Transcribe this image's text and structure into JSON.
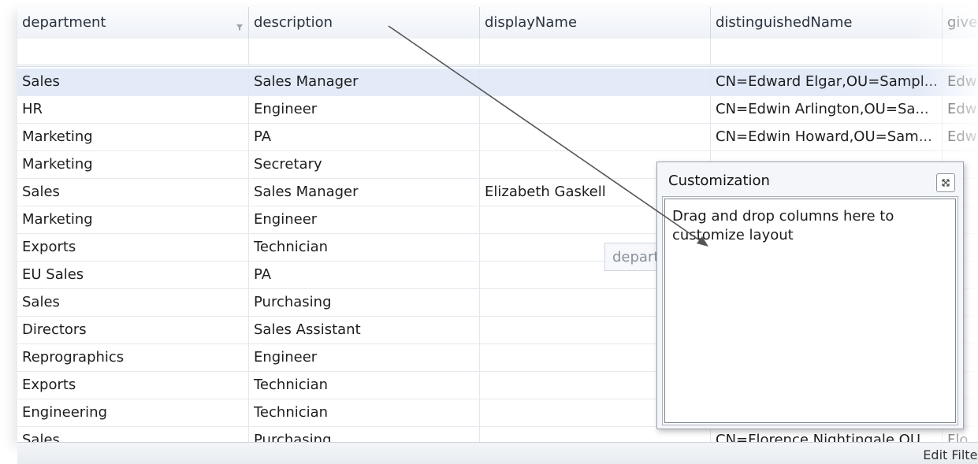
{
  "grid": {
    "columns": [
      "department",
      "description",
      "displayName",
      "distinguishedName",
      "givenName"
    ],
    "rows": [
      [
        "Sales",
        "Sales Manager",
        "",
        "CN=Edward Elgar,OU=Sampl...",
        "Edw"
      ],
      [
        "HR",
        "Engineer",
        "",
        "CN=Edwin Arlington,OU=Sa...",
        "Edw"
      ],
      [
        "Marketing",
        "PA",
        "",
        "CN=Edwin Howard,OU=Sam...",
        "Edw"
      ],
      [
        "Marketing",
        "Secretary",
        "",
        "",
        ""
      ],
      [
        "Sales",
        "Sales Manager",
        "Elizabeth Gaskell",
        "",
        ""
      ],
      [
        "Marketing",
        "Engineer",
        "",
        "",
        ""
      ],
      [
        "Exports",
        "Technician",
        "",
        "",
        ""
      ],
      [
        "EU Sales",
        "PA",
        "",
        "",
        ""
      ],
      [
        "Sales",
        "Purchasing",
        "",
        "",
        ""
      ],
      [
        "Directors",
        "Sales Assistant",
        "",
        "",
        ""
      ],
      [
        "Reprographics",
        "Engineer",
        "",
        "",
        ""
      ],
      [
        "Exports",
        "Technician",
        "",
        "",
        ""
      ],
      [
        "Engineering",
        "Technician",
        "",
        "",
        ""
      ],
      [
        "Sales",
        "Purchasing",
        "",
        "CN=Florence Nightingale,OU...",
        "Flo"
      ]
    ],
    "selected_row": 0
  },
  "footer": {
    "edit_filter": "Edit Filter"
  },
  "customization": {
    "title": "Customization",
    "hint": "Drag and drop columns here to customize layout",
    "close_icon": "close-icon"
  },
  "drag_ghost": {
    "label": "department"
  }
}
